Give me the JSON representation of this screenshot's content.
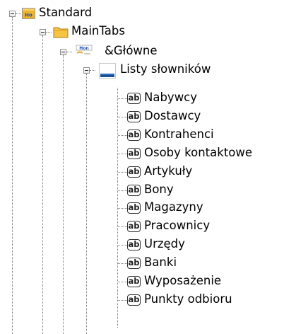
{
  "tree": {
    "root": {
      "label": "Standard",
      "icon": "form-icon"
    },
    "level1": {
      "label": "MainTabs",
      "icon": "folder-icon"
    },
    "level2": {
      "label": "&Główne",
      "icon": "tab-page-icon"
    },
    "level3": {
      "label": "Listy słowników",
      "icon": "panel-icon"
    },
    "leaf_icon_text": "ab",
    "leaves": [
      "Nabywcy",
      "Dostawcy",
      "Kontrahenci",
      "Osoby kontaktowe",
      "Artykuły",
      "Bony",
      "Magazyny",
      "Pracownicy",
      "Urzędy",
      "Banki",
      "Wyposażenie",
      "Punkty odbioru"
    ]
  },
  "colors": {
    "guide_line": "#7a7a7a",
    "folder": "#f0b429",
    "form_icon_text": "#1a4fb5"
  }
}
